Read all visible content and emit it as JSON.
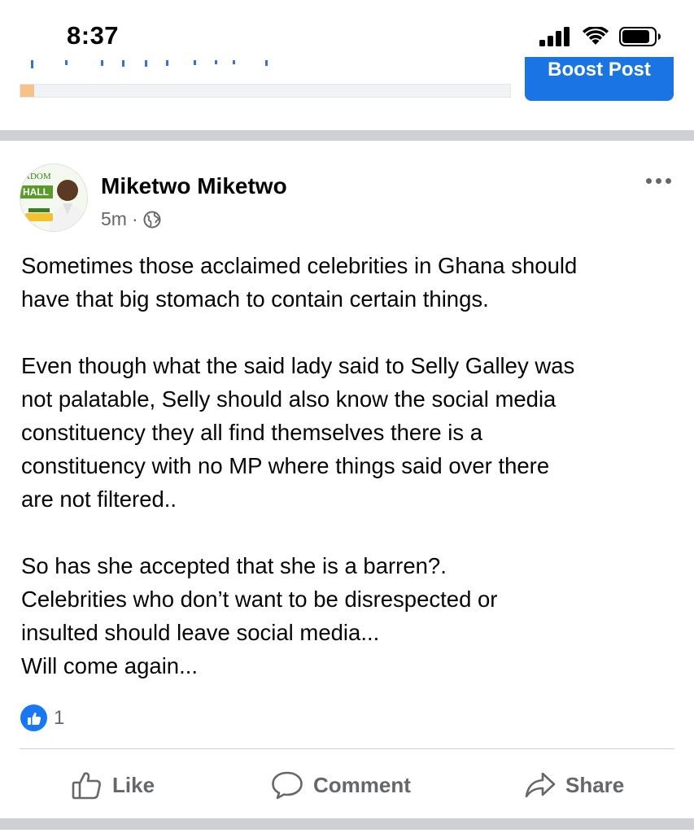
{
  "status_bar": {
    "time": "8:37",
    "icons": [
      "cellular-signal-icon",
      "wifi-icon",
      "battery-icon"
    ]
  },
  "previous_post": {
    "boost_label": "Boost Post",
    "progress_fraction": 0.028
  },
  "post": {
    "author": "Miketwo Miketwo",
    "time_ago": "5m",
    "separator": "·",
    "audience_icon": "globe-icon",
    "avatar_texts": {
      "line1": "ADOM",
      "line2": "HALL"
    },
    "paragraphs": [
      [
        "Sometimes those acclaimed celebrities in Ghana should",
        "have that big stomach to contain certain things."
      ],
      [
        "Even though what the said lady said to Selly Galley was",
        "not palatable, Selly should also know the social media",
        "constituency they all find themselves there is a",
        "constituency with no MP where things said over there",
        "are not filtered.."
      ],
      [
        "So has she accepted that she is a barren?.",
        "Celebrities who don’t want to be disrespected or",
        "insulted should leave social media...",
        "Will come again..."
      ]
    ],
    "reaction_count": "1"
  },
  "actions": {
    "like": "Like",
    "comment": "Comment",
    "share": "Share"
  },
  "colors": {
    "brand_blue": "#1877f2",
    "button_blue": "#1b74e4",
    "divider": "#ced0d4",
    "secondary_text": "#65676b"
  }
}
